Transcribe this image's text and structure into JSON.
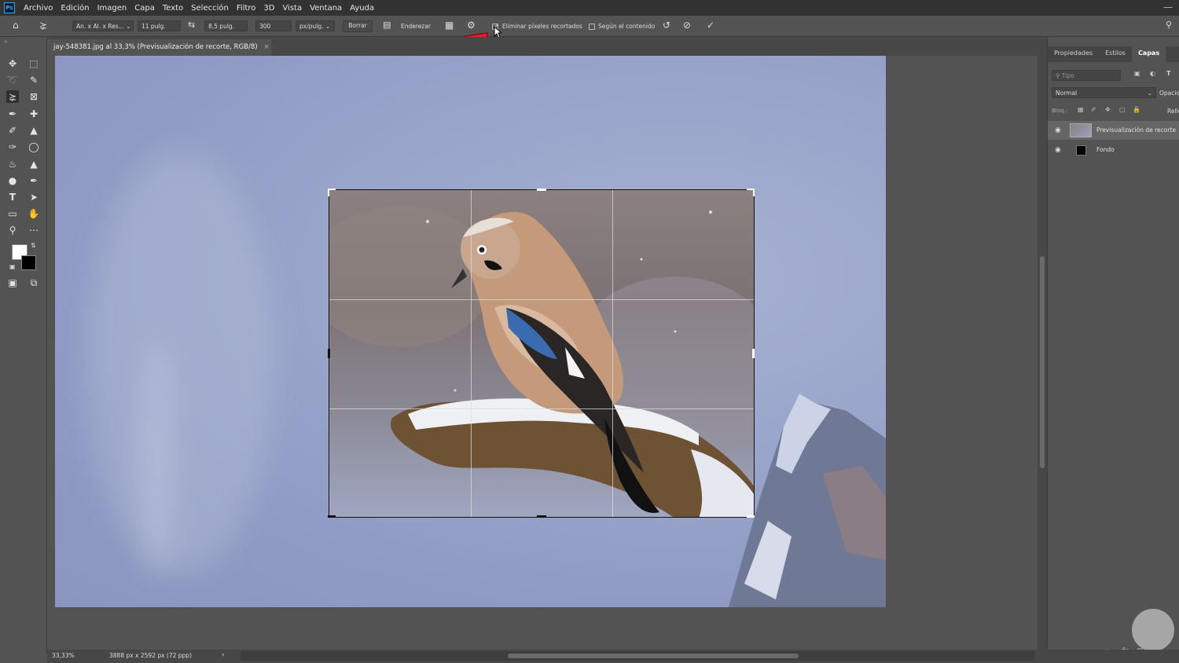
{
  "menubar": {
    "logo": "Ps",
    "items": [
      "Archivo",
      "Edición",
      "Imagen",
      "Capa",
      "Texto",
      "Selección",
      "Filtro",
      "3D",
      "Vista",
      "Ventana",
      "Ayuda"
    ]
  },
  "options": {
    "ratio_preset": "An. x Al. x Res...",
    "width": "11 pulg.",
    "height": "8,5 pulg.",
    "resolution": "300",
    "resolution_unit": "px/pulg.",
    "clear_label": "Borrar",
    "straighten_label": "Enderezar",
    "delete_cropped_label": "Eliminar píxeles recortados",
    "delete_cropped_checked": true,
    "content_aware_label": "Según el contenido",
    "content_aware_checked": false
  },
  "document": {
    "tab_title": "jay-548381.jpg al 33,3% (Previsualización de recorte, RGB/8)"
  },
  "panel": {
    "tabs": [
      "Propiedades",
      "Estilos",
      "Capas"
    ],
    "active_tab": "Capas",
    "search_placeholder": "Tipo",
    "blend_mode": "Normal",
    "opacity_label": "Opacid",
    "lock_label": "Bloq.:",
    "fill_label": "Relle",
    "layers": [
      {
        "name": "Previsualización de recorte",
        "selected": true
      },
      {
        "name": "Fondo",
        "selected": false
      }
    ]
  },
  "status": {
    "zoom": "33,33%",
    "doc_info": "3888 px x 2592 px (72 ppp)"
  },
  "colors": {
    "accent_arrow": "#e1222a",
    "foreground": "#ffffff",
    "background": "#000000"
  }
}
